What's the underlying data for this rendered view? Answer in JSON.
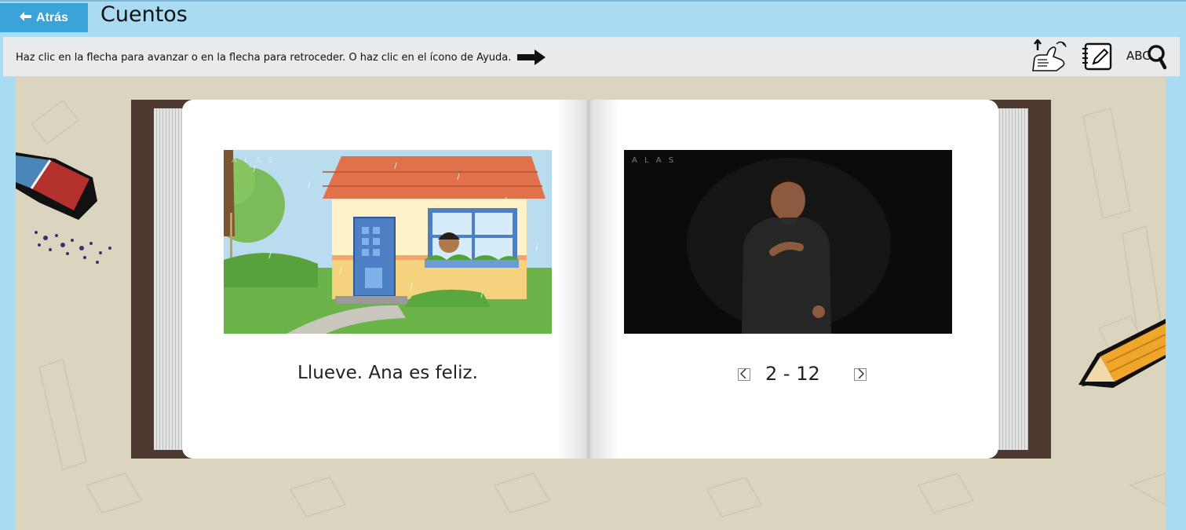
{
  "header": {
    "back_label": "Atrás",
    "title": "Cuentos"
  },
  "instructions": {
    "text": "Haz clic en la flecha para avanzar o en la flecha para retroceder. O haz clic en el ícono de Ayuda."
  },
  "toolbar": {
    "icons": [
      "sign-language-help-icon",
      "notebook-pencil-icon",
      "abc-search-icon"
    ]
  },
  "story": {
    "caption": "Llueve. Ana es feliz.",
    "page_indicator": "2 - 12",
    "watermark": "A L A S"
  },
  "colors": {
    "accent": "#3aa3d9",
    "background": "#a9dcf2",
    "book_cover": "#4e3a31",
    "stage": "#dbd5c0"
  }
}
